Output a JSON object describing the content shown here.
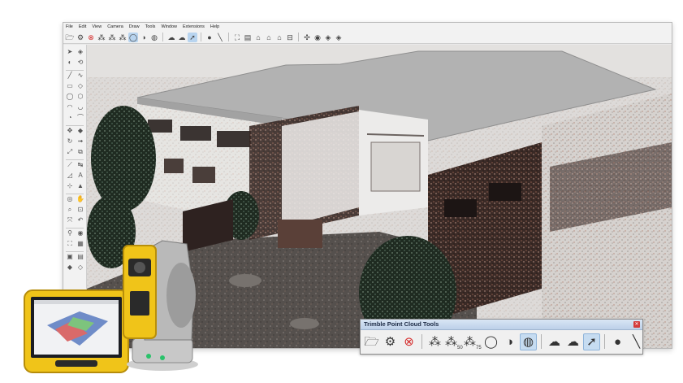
{
  "menu": [
    "File",
    "Edit",
    "View",
    "Camera",
    "Draw",
    "Tools",
    "Window",
    "Extensions",
    "Help"
  ],
  "toolbar_icons": [
    {
      "name": "open-folder-icon",
      "glyph": "🗁"
    },
    {
      "name": "settings-icon",
      "glyph": "⚙"
    },
    {
      "name": "close-circle-icon",
      "glyph": "⊗",
      "color": "red"
    },
    {
      "name": "point-cloud-icon",
      "glyph": "⁂"
    },
    {
      "name": "point-cloud-50-icon",
      "glyph": "⁂"
    },
    {
      "name": "point-cloud-75-icon",
      "glyph": "⁂"
    },
    {
      "name": "drop-icon",
      "glyph": "◯",
      "selected": true
    },
    {
      "name": "contrast-icon",
      "glyph": "◑"
    },
    {
      "name": "hatch-circle-icon",
      "glyph": "◍"
    },
    {
      "sep": true
    },
    {
      "name": "cloud-down-icon",
      "glyph": "☁"
    },
    {
      "name": "cloud-up-icon",
      "glyph": "☁"
    },
    {
      "name": "cursor-cloud-icon",
      "glyph": "➚",
      "selected": true
    },
    {
      "sep": true
    },
    {
      "name": "point-icon",
      "glyph": "●"
    },
    {
      "name": "line-icon",
      "glyph": "╲"
    },
    {
      "sep": true
    },
    {
      "name": "scene-icon-1",
      "glyph": "⛶"
    },
    {
      "name": "scene-icon-2",
      "glyph": "▤"
    },
    {
      "name": "home-icon",
      "glyph": "⌂"
    },
    {
      "name": "scene-icon-3",
      "glyph": "⌂"
    },
    {
      "name": "scene-icon-4",
      "glyph": "⌂"
    },
    {
      "name": "scene-icon-5",
      "glyph": "⊟"
    },
    {
      "sep": true
    },
    {
      "name": "axes-icon",
      "glyph": "✣"
    },
    {
      "name": "globe-icon",
      "glyph": "◉"
    },
    {
      "name": "model-icon",
      "glyph": "◈"
    },
    {
      "name": "geo-icon",
      "glyph": "◈"
    }
  ],
  "sidebar_icons": [
    [
      "select-arrow-icon",
      "➤",
      "eraser-icon",
      "◈"
    ],
    [
      "paint-bucket-icon",
      "◐",
      "tape-icon",
      "⟲"
    ],
    [
      "line-tool-icon",
      "╱",
      "freehand-icon",
      "∿"
    ],
    [
      "rectangle-icon",
      "▭",
      "rotated-rect-icon",
      "◇"
    ],
    [
      "circle-icon",
      "◯",
      "polygon-icon",
      "⬡"
    ],
    [
      "arc-icon",
      "◠",
      "arc2-icon",
      "◡"
    ],
    [
      "pie-icon",
      "◔",
      "arc3-icon",
      "⌒"
    ],
    [
      "move-icon",
      "✥",
      "pushpull-icon",
      "◆"
    ],
    [
      "rotate-icon",
      "↻",
      "followme-icon",
      "➟"
    ],
    [
      "scale-icon",
      "⤢",
      "offset-icon",
      "⧉"
    ],
    [
      "tape-measure-icon",
      "⟋",
      "dimension-icon",
      "↹"
    ],
    [
      "protractor-icon",
      "◿",
      "text-tool-icon",
      "A"
    ],
    [
      "axes-tool-icon",
      "⊹",
      "3d-text-icon",
      "▲"
    ],
    [
      "orbit-icon",
      "◎",
      "pan-icon",
      "✋"
    ],
    [
      "zoom-icon",
      "⌕",
      "zoom-window-icon",
      "⊡"
    ],
    [
      "zoom-extents-icon",
      "⤧",
      "previous-view-icon",
      "↶"
    ],
    [
      "position-camera-icon",
      "⚲",
      "lookaround-icon",
      "◉"
    ],
    [
      "walk-icon",
      "⛶",
      "section-icon",
      "▦"
    ],
    [
      "warehouse-icon",
      "▣",
      "extension-icon",
      "▤"
    ],
    [
      "ruby-icon",
      "◆",
      "layout-icon",
      "◇"
    ]
  ],
  "panel": {
    "title": "Trimble Point Cloud Tools",
    "tools": [
      {
        "name": "open-folder-icon",
        "glyph": "🗁"
      },
      {
        "name": "settings-icon",
        "glyph": "⚙"
      },
      {
        "name": "close-circle-icon",
        "glyph": "⊗",
        "color": "red"
      },
      {
        "sep": true
      },
      {
        "name": "point-cloud-icon",
        "glyph": "⁂"
      },
      {
        "name": "point-cloud-50-icon",
        "glyph": "⁂",
        "label": "50"
      },
      {
        "name": "point-cloud-75-icon",
        "glyph": "⁂",
        "label": "75"
      },
      {
        "name": "drop-icon",
        "glyph": "◯"
      },
      {
        "name": "contrast-icon",
        "glyph": "◑"
      },
      {
        "name": "hatch-circle-icon",
        "glyph": "◍",
        "selected": true
      },
      {
        "sep": true
      },
      {
        "name": "cloud-down-icon",
        "glyph": "☁"
      },
      {
        "name": "cloud-up-icon",
        "glyph": "☁"
      },
      {
        "name": "cursor-cloud-icon",
        "glyph": "➚",
        "selected": true
      },
      {
        "sep": true
      },
      {
        "name": "point-icon",
        "glyph": "●"
      },
      {
        "name": "line-icon",
        "glyph": "╲"
      }
    ]
  },
  "colors": {
    "panel_title_bg": "#c8d9ee",
    "close_red": "#d43a3a",
    "selected_bg": "#c6dcf1",
    "device_yellow": "#f0c419"
  }
}
